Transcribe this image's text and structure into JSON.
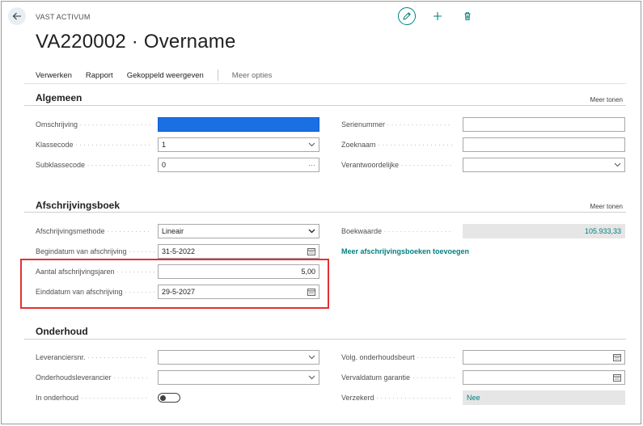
{
  "header": {
    "entity_type": "VAST ACTIVUM",
    "title": "VA220002 · Overname"
  },
  "actions": {
    "items": [
      "Verwerken",
      "Rapport",
      "Gekoppeld weergeven"
    ],
    "more": "Meer opties"
  },
  "sections": {
    "general": {
      "title": "Algemeen",
      "show_more": "Meer tonen",
      "left": [
        {
          "label": "Omschrijving",
          "value": ""
        },
        {
          "label": "Klassecode",
          "value": "1"
        },
        {
          "label": "Subklassecode",
          "value": "0"
        }
      ],
      "right": [
        {
          "label": "Serienummer",
          "value": ""
        },
        {
          "label": "Zoeknaam",
          "value": ""
        },
        {
          "label": "Verantwoordelijke",
          "value": ""
        }
      ]
    },
    "depreciation": {
      "title": "Afschrijvingsboek",
      "show_more": "Meer tonen",
      "left": [
        {
          "label": "Afschrijvingsmethode",
          "value": "Lineair"
        },
        {
          "label": "Begindatum van afschrijving",
          "value": "31-5-2022"
        },
        {
          "label": "Aantal afschrijvingsjaren",
          "value": "5,00"
        },
        {
          "label": "Einddatum van afschrijving",
          "value": "29-5-2027"
        }
      ],
      "right": [
        {
          "label": "Boekwaarde",
          "value": "105.933,33"
        }
      ],
      "add_link": "Meer afschrijvingsboeken toevoegen"
    },
    "maintenance": {
      "title": "Onderhoud",
      "left": [
        {
          "label": "Leveranciersnr.",
          "value": ""
        },
        {
          "label": "Onderhoudsleverancier",
          "value": ""
        },
        {
          "label": "In onderhoud",
          "value": ""
        }
      ],
      "right": [
        {
          "label": "Volg. onderhoudsbeurt",
          "value": ""
        },
        {
          "label": "Vervaldatum garantie",
          "value": ""
        },
        {
          "label": "Verzekerd",
          "value": "Nee"
        }
      ]
    }
  },
  "icons": {
    "back": "back-arrow-icon",
    "edit": "pencil-icon",
    "add": "plus-icon",
    "delete": "trash-icon"
  },
  "colors": {
    "accent": "#00817f",
    "highlight": "#e53030",
    "selection": "#1a6fe3"
  }
}
